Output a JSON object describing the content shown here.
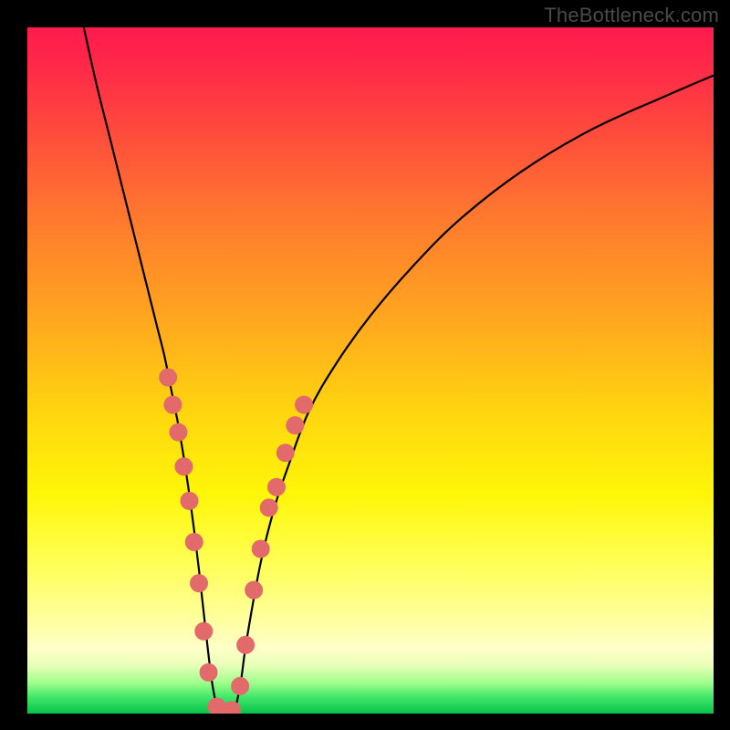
{
  "watermark": "TheBottleneck.com",
  "chart_data": {
    "type": "line",
    "title": "",
    "xlabel": "",
    "ylabel": "",
    "xlim": [
      0,
      100
    ],
    "ylim": [
      0,
      100
    ],
    "background_gradient_stops": [
      {
        "offset": 0.0,
        "color": "#ff1a4e"
      },
      {
        "offset": 0.06,
        "color": "#ff2a48"
      },
      {
        "offset": 0.15,
        "color": "#ff4a3c"
      },
      {
        "offset": 0.28,
        "color": "#ff7a2e"
      },
      {
        "offset": 0.42,
        "color": "#ffa51f"
      },
      {
        "offset": 0.56,
        "color": "#ffd50f"
      },
      {
        "offset": 0.68,
        "color": "#fff608"
      },
      {
        "offset": 0.78,
        "color": "#ffff55"
      },
      {
        "offset": 0.86,
        "color": "#ffff9c"
      },
      {
        "offset": 0.905,
        "color": "#ffffc8"
      },
      {
        "offset": 0.93,
        "color": "#e8ffb8"
      },
      {
        "offset": 0.955,
        "color": "#a0ff8c"
      },
      {
        "offset": 0.975,
        "color": "#45e86a"
      },
      {
        "offset": 1.0,
        "color": "#07c24a"
      }
    ],
    "series": [
      {
        "name": "bottleneck-curve",
        "x": [
          8,
          10,
          12,
          14,
          16,
          18,
          19,
          20,
          21,
          22,
          23,
          24,
          25,
          26,
          27,
          28,
          29,
          30,
          31,
          32,
          34,
          36,
          38,
          41,
          45,
          50,
          56,
          63,
          72,
          82,
          93,
          100
        ],
        "y": [
          101,
          92,
          84,
          76,
          68,
          60,
          56,
          52,
          47,
          42,
          36,
          29,
          21,
          12,
          4,
          0,
          0,
          0,
          4,
          11,
          22,
          30,
          36,
          44,
          51,
          58,
          65,
          72,
          79,
          85,
          90,
          93
        ]
      }
    ],
    "scatter_points": {
      "name": "highlight-dots",
      "color": "#e26a6a",
      "radius": 10,
      "points": [
        {
          "x": 20.5,
          "y": 49
        },
        {
          "x": 21.2,
          "y": 45
        },
        {
          "x": 22.0,
          "y": 41
        },
        {
          "x": 22.8,
          "y": 36
        },
        {
          "x": 23.6,
          "y": 31
        },
        {
          "x": 24.3,
          "y": 25
        },
        {
          "x": 25.0,
          "y": 19
        },
        {
          "x": 25.7,
          "y": 12
        },
        {
          "x": 26.4,
          "y": 6
        },
        {
          "x": 27.6,
          "y": 1
        },
        {
          "x": 28.6,
          "y": 0
        },
        {
          "x": 29.8,
          "y": 0.5
        },
        {
          "x": 31.0,
          "y": 4
        },
        {
          "x": 31.8,
          "y": 10
        },
        {
          "x": 33.0,
          "y": 18
        },
        {
          "x": 34.0,
          "y": 24
        },
        {
          "x": 35.2,
          "y": 30
        },
        {
          "x": 36.3,
          "y": 33
        },
        {
          "x": 37.6,
          "y": 38
        },
        {
          "x": 39.0,
          "y": 42
        },
        {
          "x": 40.3,
          "y": 45
        }
      ]
    }
  }
}
